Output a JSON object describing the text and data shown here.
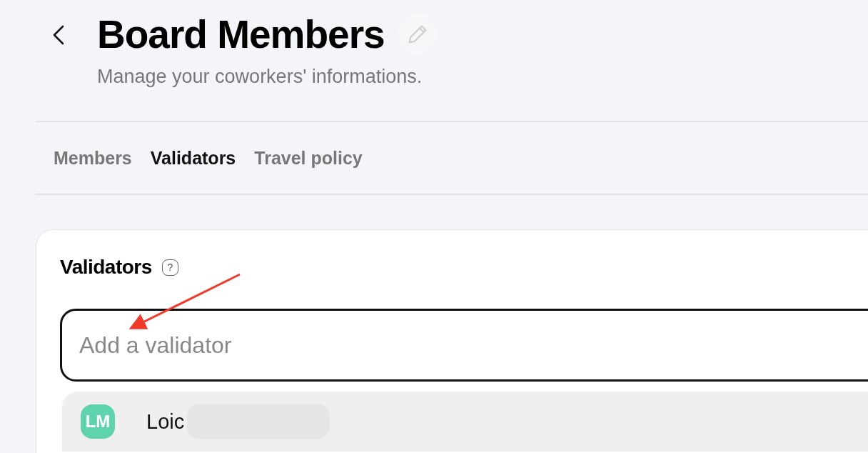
{
  "header": {
    "title": "Board Members",
    "subtitle": "Manage your coworkers' informations."
  },
  "tabs": [
    {
      "label": "Members",
      "selected": false
    },
    {
      "label": "Validators",
      "selected": true
    },
    {
      "label": "Travel policy",
      "selected": false
    }
  ],
  "card": {
    "heading": "Validators",
    "help": "?",
    "input": {
      "placeholder": "Add a validator"
    },
    "options": [
      {
        "initials": "LM",
        "name": "Loic"
      }
    ]
  }
}
